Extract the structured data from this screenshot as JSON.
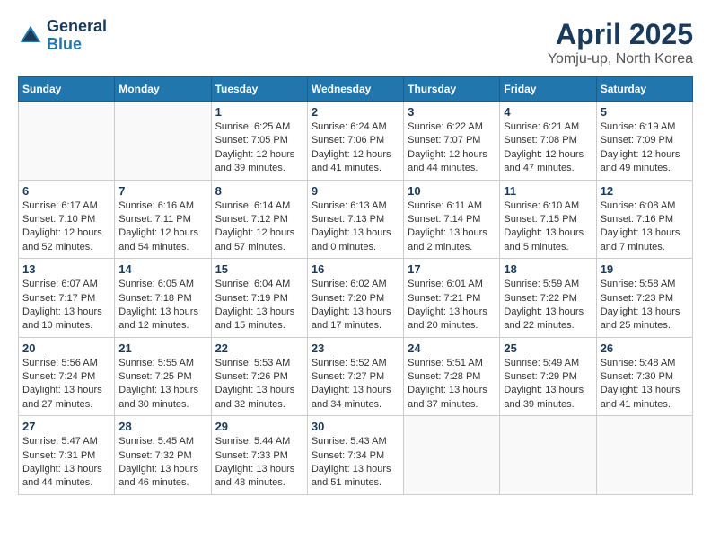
{
  "header": {
    "logo_line1": "General",
    "logo_line2": "Blue",
    "month": "April 2025",
    "location": "Yomju-up, North Korea"
  },
  "weekdays": [
    "Sunday",
    "Monday",
    "Tuesday",
    "Wednesday",
    "Thursday",
    "Friday",
    "Saturday"
  ],
  "weeks": [
    [
      {
        "day": "",
        "info": ""
      },
      {
        "day": "",
        "info": ""
      },
      {
        "day": "1",
        "info": "Sunrise: 6:25 AM\nSunset: 7:05 PM\nDaylight: 12 hours and 39 minutes."
      },
      {
        "day": "2",
        "info": "Sunrise: 6:24 AM\nSunset: 7:06 PM\nDaylight: 12 hours and 41 minutes."
      },
      {
        "day": "3",
        "info": "Sunrise: 6:22 AM\nSunset: 7:07 PM\nDaylight: 12 hours and 44 minutes."
      },
      {
        "day": "4",
        "info": "Sunrise: 6:21 AM\nSunset: 7:08 PM\nDaylight: 12 hours and 47 minutes."
      },
      {
        "day": "5",
        "info": "Sunrise: 6:19 AM\nSunset: 7:09 PM\nDaylight: 12 hours and 49 minutes."
      }
    ],
    [
      {
        "day": "6",
        "info": "Sunrise: 6:17 AM\nSunset: 7:10 PM\nDaylight: 12 hours and 52 minutes."
      },
      {
        "day": "7",
        "info": "Sunrise: 6:16 AM\nSunset: 7:11 PM\nDaylight: 12 hours and 54 minutes."
      },
      {
        "day": "8",
        "info": "Sunrise: 6:14 AM\nSunset: 7:12 PM\nDaylight: 12 hours and 57 minutes."
      },
      {
        "day": "9",
        "info": "Sunrise: 6:13 AM\nSunset: 7:13 PM\nDaylight: 13 hours and 0 minutes."
      },
      {
        "day": "10",
        "info": "Sunrise: 6:11 AM\nSunset: 7:14 PM\nDaylight: 13 hours and 2 minutes."
      },
      {
        "day": "11",
        "info": "Sunrise: 6:10 AM\nSunset: 7:15 PM\nDaylight: 13 hours and 5 minutes."
      },
      {
        "day": "12",
        "info": "Sunrise: 6:08 AM\nSunset: 7:16 PM\nDaylight: 13 hours and 7 minutes."
      }
    ],
    [
      {
        "day": "13",
        "info": "Sunrise: 6:07 AM\nSunset: 7:17 PM\nDaylight: 13 hours and 10 minutes."
      },
      {
        "day": "14",
        "info": "Sunrise: 6:05 AM\nSunset: 7:18 PM\nDaylight: 13 hours and 12 minutes."
      },
      {
        "day": "15",
        "info": "Sunrise: 6:04 AM\nSunset: 7:19 PM\nDaylight: 13 hours and 15 minutes."
      },
      {
        "day": "16",
        "info": "Sunrise: 6:02 AM\nSunset: 7:20 PM\nDaylight: 13 hours and 17 minutes."
      },
      {
        "day": "17",
        "info": "Sunrise: 6:01 AM\nSunset: 7:21 PM\nDaylight: 13 hours and 20 minutes."
      },
      {
        "day": "18",
        "info": "Sunrise: 5:59 AM\nSunset: 7:22 PM\nDaylight: 13 hours and 22 minutes."
      },
      {
        "day": "19",
        "info": "Sunrise: 5:58 AM\nSunset: 7:23 PM\nDaylight: 13 hours and 25 minutes."
      }
    ],
    [
      {
        "day": "20",
        "info": "Sunrise: 5:56 AM\nSunset: 7:24 PM\nDaylight: 13 hours and 27 minutes."
      },
      {
        "day": "21",
        "info": "Sunrise: 5:55 AM\nSunset: 7:25 PM\nDaylight: 13 hours and 30 minutes."
      },
      {
        "day": "22",
        "info": "Sunrise: 5:53 AM\nSunset: 7:26 PM\nDaylight: 13 hours and 32 minutes."
      },
      {
        "day": "23",
        "info": "Sunrise: 5:52 AM\nSunset: 7:27 PM\nDaylight: 13 hours and 34 minutes."
      },
      {
        "day": "24",
        "info": "Sunrise: 5:51 AM\nSunset: 7:28 PM\nDaylight: 13 hours and 37 minutes."
      },
      {
        "day": "25",
        "info": "Sunrise: 5:49 AM\nSunset: 7:29 PM\nDaylight: 13 hours and 39 minutes."
      },
      {
        "day": "26",
        "info": "Sunrise: 5:48 AM\nSunset: 7:30 PM\nDaylight: 13 hours and 41 minutes."
      }
    ],
    [
      {
        "day": "27",
        "info": "Sunrise: 5:47 AM\nSunset: 7:31 PM\nDaylight: 13 hours and 44 minutes."
      },
      {
        "day": "28",
        "info": "Sunrise: 5:45 AM\nSunset: 7:32 PM\nDaylight: 13 hours and 46 minutes."
      },
      {
        "day": "29",
        "info": "Sunrise: 5:44 AM\nSunset: 7:33 PM\nDaylight: 13 hours and 48 minutes."
      },
      {
        "day": "30",
        "info": "Sunrise: 5:43 AM\nSunset: 7:34 PM\nDaylight: 13 hours and 51 minutes."
      },
      {
        "day": "",
        "info": ""
      },
      {
        "day": "",
        "info": ""
      },
      {
        "day": "",
        "info": ""
      }
    ]
  ]
}
